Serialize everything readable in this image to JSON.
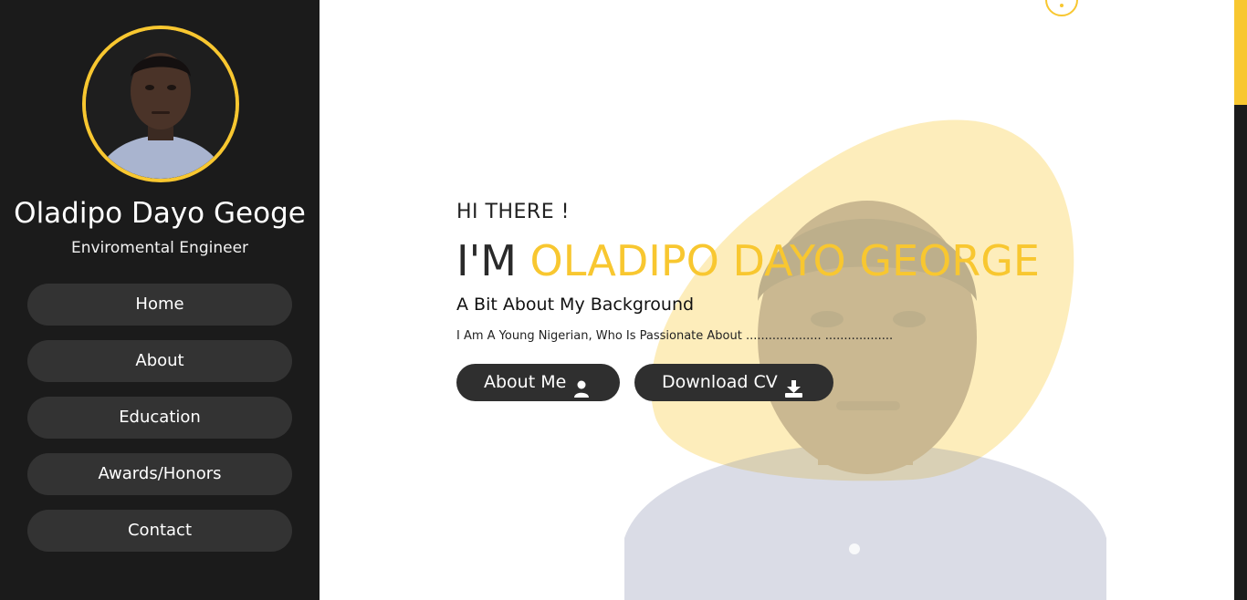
{
  "sidebar": {
    "name": "Oladipo Dayo Geoge",
    "role": "Enviromental Engineer",
    "nav": [
      {
        "label": "Home"
      },
      {
        "label": "About"
      },
      {
        "label": "Education"
      },
      {
        "label": "Awards/Honors"
      },
      {
        "label": "Contact"
      }
    ]
  },
  "hero": {
    "greeting": "HI THERE !",
    "im_prefix": "I'M",
    "name_highlight": "OLADIPO DAYO GEORGE",
    "subheading": "A Bit About My Background",
    "intro": "I Am A Young Nigerian, Who Is Passionate About .................... ..................",
    "buttons": {
      "about": {
        "label": "About Me",
        "icon": "user-icon"
      },
      "download": {
        "label": "Download CV",
        "icon": "download-icon"
      }
    }
  },
  "colors": {
    "accent": "#f8c730",
    "sidebar_bg": "#1b1b1b",
    "button_bg": "#333333"
  }
}
